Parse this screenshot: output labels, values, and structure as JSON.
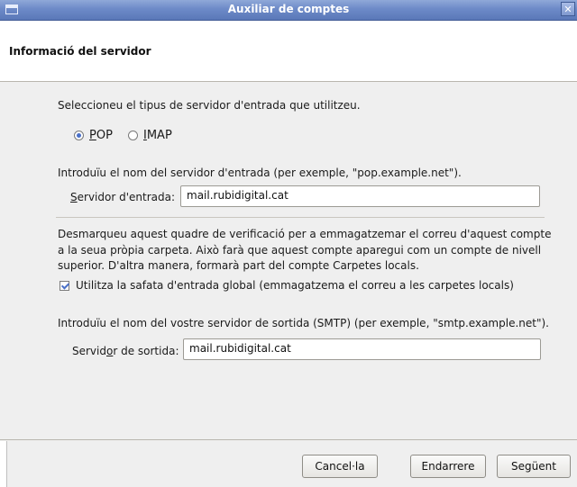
{
  "window": {
    "title": "Auxiliar de comptes",
    "close_glyph": "✕"
  },
  "header": {
    "title": "Informació del servidor"
  },
  "incoming": {
    "prompt": "Seleccioneu el tipus de servidor d'entrada que utilitzeu.",
    "options": [
      {
        "label": "POP",
        "mnemonic": "P",
        "rest": "OP",
        "selected": true
      },
      {
        "label": "IMAP",
        "mnemonic": "I",
        "rest": "MAP",
        "selected": false
      }
    ],
    "hint": "Introduïu el nom del servidor d'entrada (per exemple, \"pop.example.net\").",
    "field_label_mnemonic": "S",
    "field_label_rest": "ervidor d'entrada:",
    "field_value": "mail.rubidigital.cat"
  },
  "global_inbox": {
    "description_line1": "Desmarqueu aquest quadre de verificació per a emmagatzemar el correu d'aquest compte",
    "description_line2": "a la seua pròpia carpeta. Això farà que aquest compte aparegui com un compte de nivell",
    "description_line3": "superior. D'altra manera, formarà part del compte Carpetes locals.",
    "checkbox_label": "Utilitza la safata d'entrada global (emmagatzema el correu a les carpetes locals)",
    "checked": true
  },
  "outgoing": {
    "hint": "Introduïu el nom del vostre servidor de sortida (SMTP) (per exemple, \"smtp.example.net\").",
    "field_label_before": "Servid",
    "field_label_mnemonic": "o",
    "field_label_after": "r de sortida:",
    "field_value": "mail.rubidigital.cat"
  },
  "buttons": {
    "cancel": "Cancel·la",
    "back": "Endarrere",
    "next": "Següent"
  }
}
